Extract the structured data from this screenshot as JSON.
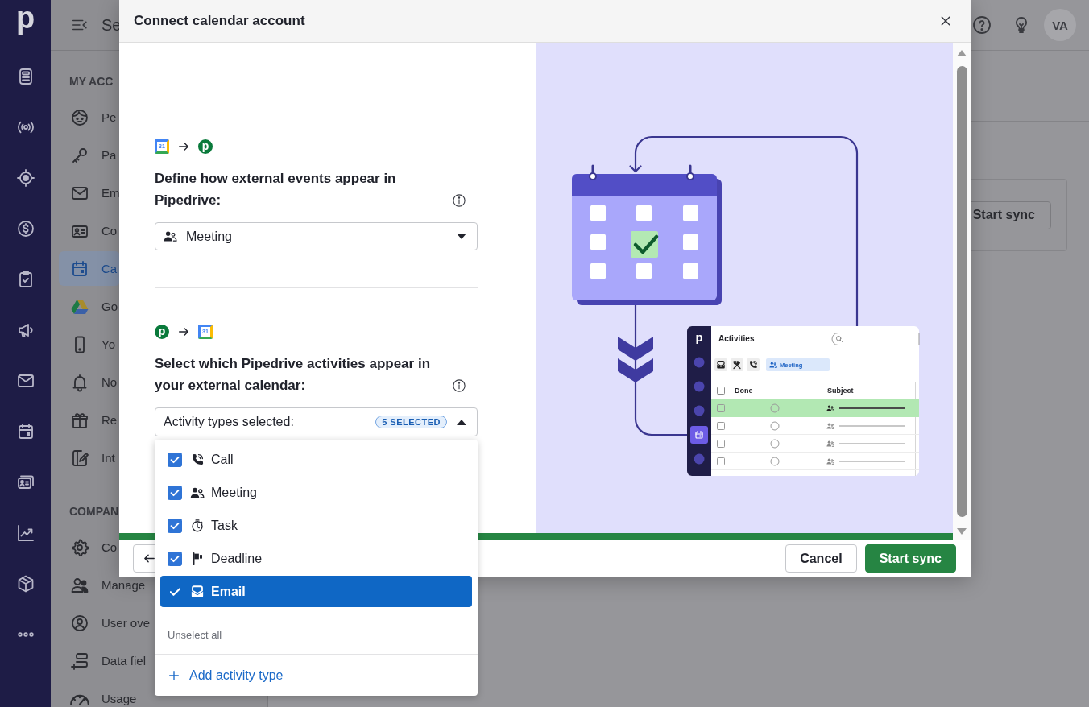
{
  "rail": {
    "logo": "p"
  },
  "sidebar": {
    "header": "Se",
    "sections": [
      {
        "title": "MY ACC",
        "items": [
          {
            "label": "Pe",
            "selected": false
          },
          {
            "label": "Pa",
            "selected": false
          },
          {
            "label": "Em",
            "selected": false
          },
          {
            "label": "Co",
            "selected": false
          },
          {
            "label": "Ca",
            "selected": true
          },
          {
            "label": "Go",
            "selected": false
          },
          {
            "label": "Yo",
            "selected": false
          },
          {
            "label": "No",
            "selected": false
          },
          {
            "label": "Re",
            "selected": false
          },
          {
            "label": "Int",
            "selected": false
          }
        ]
      },
      {
        "title": "COMPAN",
        "items": [
          {
            "label": "Co",
            "selected": false
          },
          {
            "label": "Manage",
            "selected": false
          },
          {
            "label": "User ove",
            "selected": false
          },
          {
            "label": "Data fiel",
            "selected": false
          },
          {
            "label": "Usage",
            "selected": false
          }
        ]
      }
    ]
  },
  "top_bar": {
    "avatar": "VA"
  },
  "page": {
    "sync_button": "Start sync"
  },
  "modal": {
    "title": "Connect calendar account",
    "inbound": {
      "flow": [
        {
          "kind": "calendar",
          "text": "31"
        },
        {
          "kind": "crm",
          "text": "p"
        }
      ],
      "heading": "Define how external events appear in Pipedrive:",
      "select": {
        "value": "Meeting"
      }
    },
    "outbound": {
      "flow": [
        {
          "kind": "crm",
          "text": "p"
        },
        {
          "kind": "calendar",
          "text": "31"
        }
      ],
      "heading": "Select which Pipedrive activities appear in your external calendar:",
      "multiselect": {
        "label": "Activity types selected:",
        "badge": "5 SELECTED",
        "open": true,
        "options": [
          {
            "label": "Call",
            "checked": true,
            "highlighted": false
          },
          {
            "label": "Meeting",
            "checked": true,
            "highlighted": false
          },
          {
            "label": "Task",
            "checked": true,
            "highlighted": false
          },
          {
            "label": "Deadline",
            "checked": true,
            "highlighted": false
          },
          {
            "label": "Email",
            "checked": true,
            "highlighted": true
          }
        ],
        "unselect": "Unselect all",
        "add": "Add activity type"
      }
    },
    "illustration": {
      "logo": "p",
      "title": "Activities",
      "chip": "Meeting",
      "columns": [
        "Done",
        "Subject"
      ],
      "all_checked": false,
      "nav": [
        {
          "selected": false
        },
        {
          "selected": false
        },
        {
          "selected": false
        },
        {
          "selected": true
        },
        {
          "selected": false
        }
      ],
      "rows": [
        {
          "selected": true,
          "checked": false
        },
        {
          "selected": false,
          "checked": false
        },
        {
          "selected": false,
          "checked": false
        },
        {
          "selected": false,
          "checked": false
        }
      ]
    },
    "progress": {
      "level": 1
    },
    "footer": {
      "cancel": "Cancel",
      "confirm": "Start sync"
    }
  }
}
